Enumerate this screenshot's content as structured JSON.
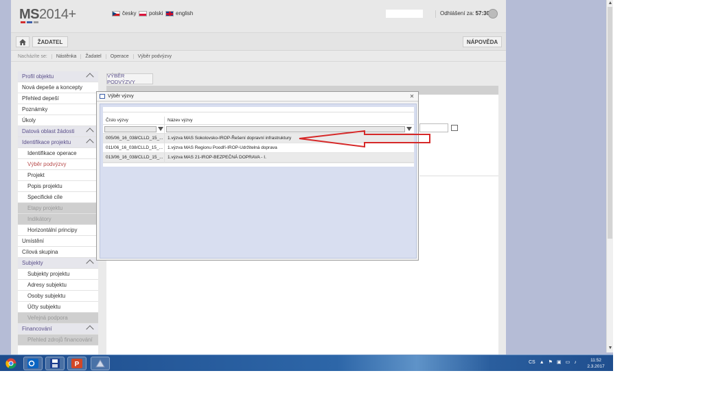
{
  "header": {
    "logo_main": "MS",
    "logo_year": "2014+",
    "logo_bar_colors": [
      "#d22f2f",
      "#3f5fa8",
      "#9b9b9b"
    ],
    "languages": [
      {
        "label": "česky",
        "icon": "flag-cz-icon"
      },
      {
        "label": "polski",
        "icon": "flag-pl-icon"
      },
      {
        "label": "english",
        "icon": "flag-en-icon"
      }
    ],
    "logout_label": "Odhlášení za:",
    "logout_time": "57:30"
  },
  "navbar": {
    "home_icon": "home-icon",
    "applicant_label": "ŽADATEL",
    "help_label": "NÁPOVĚDA"
  },
  "breadcrumb": [
    "Nacházíte se:",
    "Nástěnka",
    "Žadatel",
    "Operace",
    "Výběr podvýzvy"
  ],
  "sidebar": {
    "items": [
      {
        "label": "Profil objektu",
        "type": "section",
        "chevron": true
      },
      {
        "label": "Nová depeše a koncepty",
        "type": "item"
      },
      {
        "label": "Přehled depeší",
        "type": "item"
      },
      {
        "label": "Poznámky",
        "type": "item"
      },
      {
        "label": "Úkoly",
        "type": "item"
      },
      {
        "label": "Datová oblast žádosti",
        "type": "section",
        "chevron": true
      },
      {
        "label": "Identifikace projektu",
        "type": "section",
        "chevron": true
      },
      {
        "label": "Identifikace operace",
        "type": "sub"
      },
      {
        "label": "Výběr podvýzvy",
        "type": "sub-active"
      },
      {
        "label": "Projekt",
        "type": "sub"
      },
      {
        "label": "Popis projektu",
        "type": "sub"
      },
      {
        "label": "Specifické cíle",
        "type": "sub"
      },
      {
        "label": "Etapy projektu",
        "type": "sub-disabled"
      },
      {
        "label": "Indikátory",
        "type": "sub-disabled"
      },
      {
        "label": "Horizontální principy",
        "type": "sub"
      },
      {
        "label": "Umístění",
        "type": "item"
      },
      {
        "label": "Cílová skupina",
        "type": "item"
      },
      {
        "label": "Subjekty",
        "type": "section",
        "chevron": true
      },
      {
        "label": "Subjekty projektu",
        "type": "sub"
      },
      {
        "label": "Adresy subjektu",
        "type": "sub"
      },
      {
        "label": "Osoby subjektu",
        "type": "sub"
      },
      {
        "label": "Účty subjektu",
        "type": "sub"
      },
      {
        "label": "Veřejná podpora",
        "type": "sub-disabled"
      },
      {
        "label": "Financování",
        "type": "section",
        "chevron": true
      },
      {
        "label": "Přehled zdrojů financování",
        "type": "sub-disabled"
      }
    ]
  },
  "main": {
    "tab_label": "VÝBĚR PODVÝZVY"
  },
  "dialog": {
    "title": "Výběr výzvy",
    "columns": [
      "Číslo výzvy",
      "Název výzvy"
    ],
    "rows": [
      {
        "number": "005/06_16_038/CLLD_15_...",
        "name": "1.výzva MAS Sokolovsko-IROP-Řešení dopravní infrastruktury"
      },
      {
        "number": "011/06_16_038/CLLD_15_...",
        "name": "1.výzva MAS Regionu Poodří-IROP-Udržitelná doprava"
      },
      {
        "number": "013/06_16_038/CLLD_15_...",
        "name": "1.výzva MAS 21-IROP-BEZPEČNÁ DOPRAVA - I."
      }
    ]
  },
  "annotation": {
    "arrow_color": "#d62828"
  },
  "taskbar": {
    "apps": [
      "chrome-icon",
      "outlook-icon",
      "save-icon",
      "powerpoint-icon",
      "app-icon"
    ],
    "tray_lang": "CS",
    "time": "11:52",
    "date": "2.3.2017"
  }
}
